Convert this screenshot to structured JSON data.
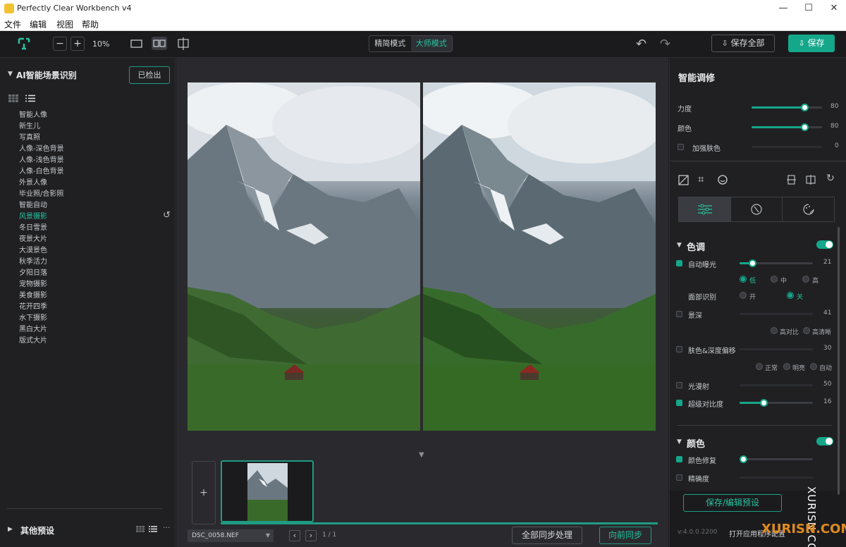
{
  "window": {
    "title": "Perfectly Clear Workbench v4",
    "minimize": "—",
    "maximize": "☐",
    "close": "✕"
  },
  "menu": [
    "文件",
    "编辑",
    "视图",
    "帮助"
  ],
  "toolbar": {
    "zoom_minus": "−",
    "zoom_plus": "+",
    "zoom_level": "10%",
    "modes": [
      "精简模式",
      "大师模式"
    ],
    "undo": "↶",
    "redo": "↷",
    "save_all": "保存全部",
    "save": "保存"
  },
  "left": {
    "section_title": "AI智能场景识别",
    "detected_button": "已检出",
    "scenes": [
      "智能人像",
      "新生儿",
      "写真照",
      "人像-深色背景",
      "人像-浅色背景",
      "人像-白色背景",
      "外景人像",
      "毕业照/合影照",
      "智能自动",
      "风景摄影",
      "冬日雪景",
      "夜景大片",
      "大漠景色",
      "秋季活力",
      "夕阳日落",
      "宠物摄影",
      "美食摄影",
      "花开四季",
      "水下摄影",
      "黑白大片",
      "版式大片"
    ],
    "active_scene_index": 9,
    "reset_icon": "↺",
    "other_presets": "其他预设"
  },
  "center": {
    "add_label": "+",
    "filename": "DSC_0058.NEF",
    "nav_prev": "‹",
    "nav_next": "›",
    "page_info": "1 / 1",
    "collapse_arrow": "▼",
    "sync_all": "全部同步处理",
    "sync_forward": "向前同步"
  },
  "right": {
    "title": "智能调修",
    "strength": {
      "label": "力度",
      "value": "80"
    },
    "color": {
      "label": "颜色",
      "value": "80"
    },
    "skin": {
      "label": "加强肤色",
      "value": "0"
    },
    "tone": {
      "title": "色调",
      "auto_exposure": {
        "label": "自动曝光",
        "value": "21"
      },
      "levels": [
        "低",
        "中",
        "高"
      ],
      "face_detect": {
        "label": "面部识别",
        "on": "开",
        "off": "关"
      },
      "depth": {
        "label": "景深",
        "value": "41"
      },
      "depth_opts": [
        "高对比",
        "高清晰"
      ],
      "skin_depth": {
        "label": "肤色&深度偏移",
        "value": "30"
      },
      "skin_opts": [
        "正常",
        "明亮",
        "自动"
      ],
      "light_diffusion": {
        "label": "光漫射",
        "value": "50"
      },
      "super_contrast": {
        "label": "超级对比度",
        "value": "16"
      }
    },
    "color_section": {
      "title": "颜色",
      "color_repair": {
        "label": "颜色修复"
      },
      "precision": {
        "label": "精确度"
      }
    },
    "save_preset": "保存/编辑预设",
    "version": "v:4.0.0.2200",
    "open_label": "打开应用程序配置"
  },
  "watermark": {
    "side": "XURISN.COM",
    "corner": "XURISN.COM"
  },
  "colors": {
    "accent": "#15a78a",
    "accent_text": "#27c3a0",
    "bg": "#1e1e21"
  }
}
